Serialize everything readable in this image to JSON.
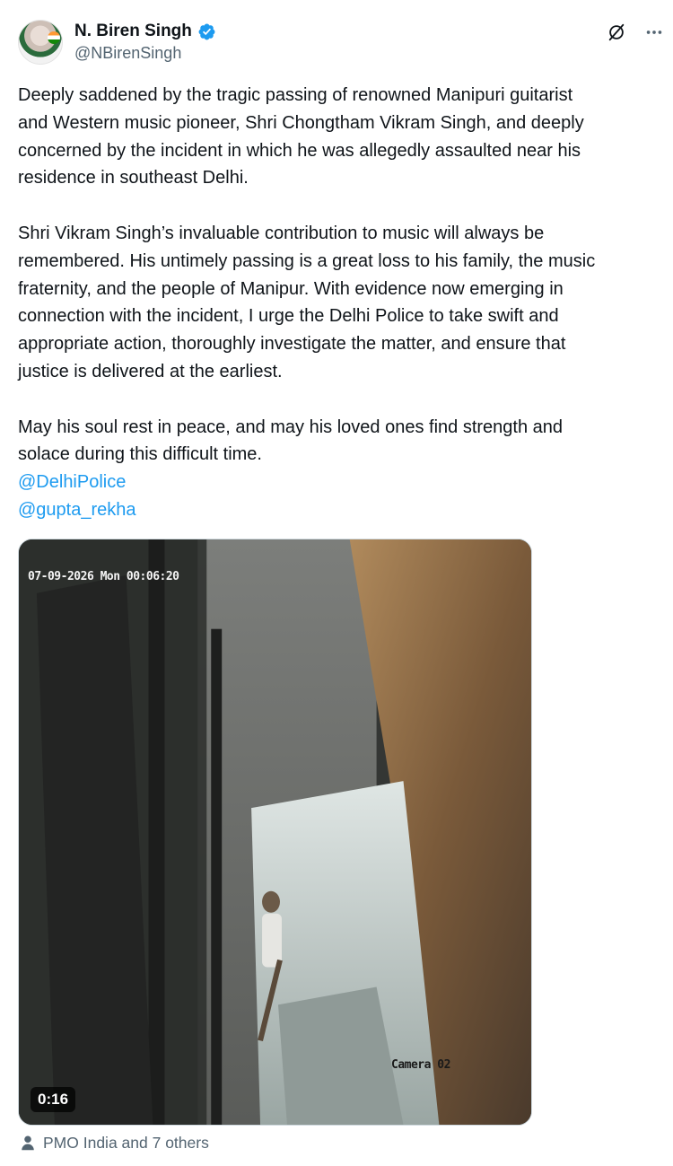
{
  "author": {
    "name": "N. Biren Singh",
    "handle": "@NBirenSingh",
    "verified": true,
    "avatar_icon": "profile-photo"
  },
  "toolbar": {
    "grok_icon": "slashed-circle-icon",
    "more_icon": "more-icon"
  },
  "tweet": {
    "paragraphs": [
      "Deeply saddened by the tragic passing of renowned Manipuri guitarist\nand Western music pioneer, Shri Chongtham Vikram Singh, and deeply\nconcerned by the incident in which he was allegedly assaulted near his\nresidence in southeast Delhi.",
      "Shri Vikram Singh’s invaluable contribution to music will always be\nremembered. His untimely passing is a great loss to his family, the music\nfraternity, and the people of Manipur. With evidence now emerging in\nconnection with the incident, I urge the Delhi Police to take swift and\nappropriate action, thoroughly investigate the matter, and ensure that\njustice is delivered at the earliest.",
      "May his soul rest in peace, and may his loved ones find strength and\nsolace during this difficult time."
    ],
    "mentions": [
      "@DelhiPolice",
      "@gupta_rekha"
    ]
  },
  "media": {
    "cctv_timestamp": "07-09-2026 Mon 00:06:20",
    "camera_label": "Camera 02",
    "duration": "0:16"
  },
  "social_context": {
    "text": "PMO India and 7 others",
    "icon": "person-icon"
  },
  "colors": {
    "link": "#1d9bf0",
    "secondary_text": "#536471",
    "verified_badge": "#1d9bf0"
  }
}
